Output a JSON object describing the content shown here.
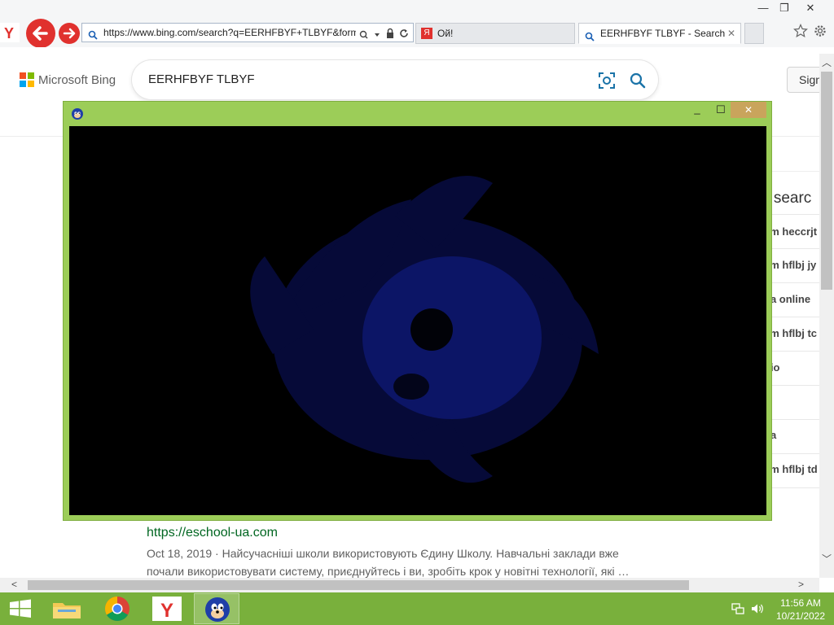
{
  "browser": {
    "address_url": "https://www.bing.com/search?q=EERHFBYF+TLBYF&form",
    "tabs": [
      {
        "label": "Ой!"
      },
      {
        "label": "EERHFBYF TLBYF - Search"
      }
    ]
  },
  "bing": {
    "logo_text": "Microsoft Bing",
    "query": "EERHFBYF TLBYF",
    "sign_in_label": "Sign",
    "related": {
      "title": "d searc",
      "items": [
        "am heccrjt",
        "am hflbj jy",
        "ua online",
        "am hflbj tc",
        "dio",
        "",
        "ua",
        "am hflbj td"
      ]
    },
    "result": {
      "url": "https://eschool-ua.com",
      "date": "Oct 18, 2019",
      "snippet": "Найсучасніші школи використовують Єдину Школу. Навчальні заклади вже почали використовувати систему, приєднуйтесь і ви, зробіть крок у новітні технології, які …"
    }
  },
  "app_window": {
    "close_symbol": "✕"
  },
  "taskbar": {
    "time": "11:56 AM",
    "date": "10/21/2022"
  },
  "colors": {
    "taskbar": "#79b03c",
    "app_frame": "#9ccd58",
    "app_close": "#c9a45c",
    "bing_link_green": "#006621",
    "back_button": "#e0312e"
  }
}
